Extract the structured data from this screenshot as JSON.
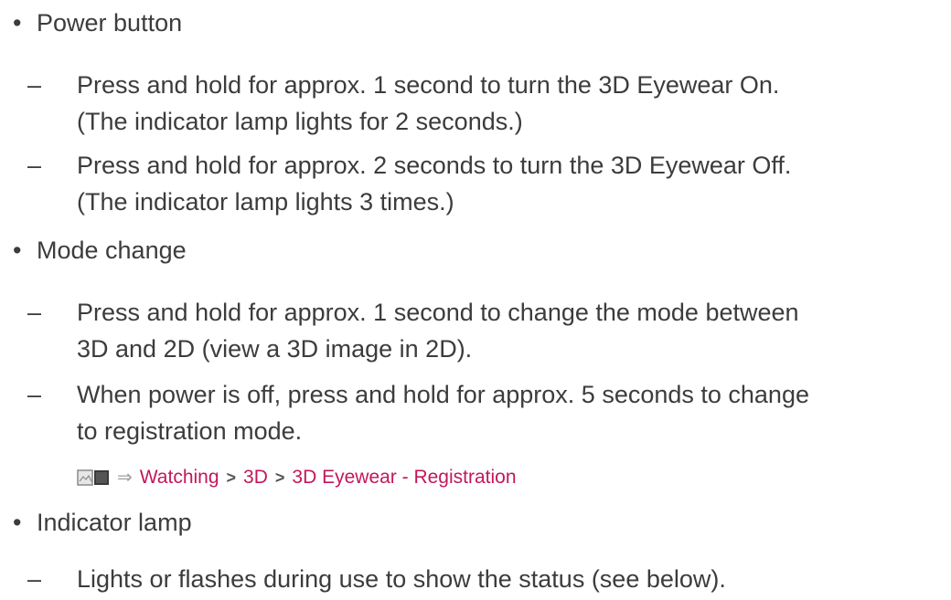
{
  "sections": [
    {
      "heading": "Power button",
      "items": [
        {
          "lines": [
            "Press and hold for approx. 1 second to turn the 3D Eyewear On.",
            "(The indicator lamp lights for 2 seconds.)"
          ]
        },
        {
          "lines": [
            "Press and hold for approx. 2 seconds to turn the 3D Eyewear Off.",
            "(The indicator lamp lights 3 times.)"
          ]
        }
      ]
    },
    {
      "heading": "Mode change",
      "items": [
        {
          "lines": [
            "Press and hold for approx. 1 second to change the mode between",
            "3D and 2D (view a 3D image in 2D)."
          ]
        },
        {
          "lines": [
            "When power is off, press and hold for approx. 5 seconds to change",
            "to registration mode."
          ]
        }
      ]
    },
    {
      "heading": "Indicator lamp",
      "items": [
        {
          "lines": [
            "Lights or flashes during use to show the status (see below)."
          ]
        }
      ]
    }
  ],
  "bullet": "•",
  "dash": "–",
  "breadcrumb": {
    "icon": "ebook-icon",
    "arrow": "⇒",
    "separator": ">",
    "links": [
      "Watching",
      "3D",
      "3D Eyewear - Registration"
    ]
  },
  "colors": {
    "text": "#3c3c3c",
    "link": "#c2185b"
  }
}
